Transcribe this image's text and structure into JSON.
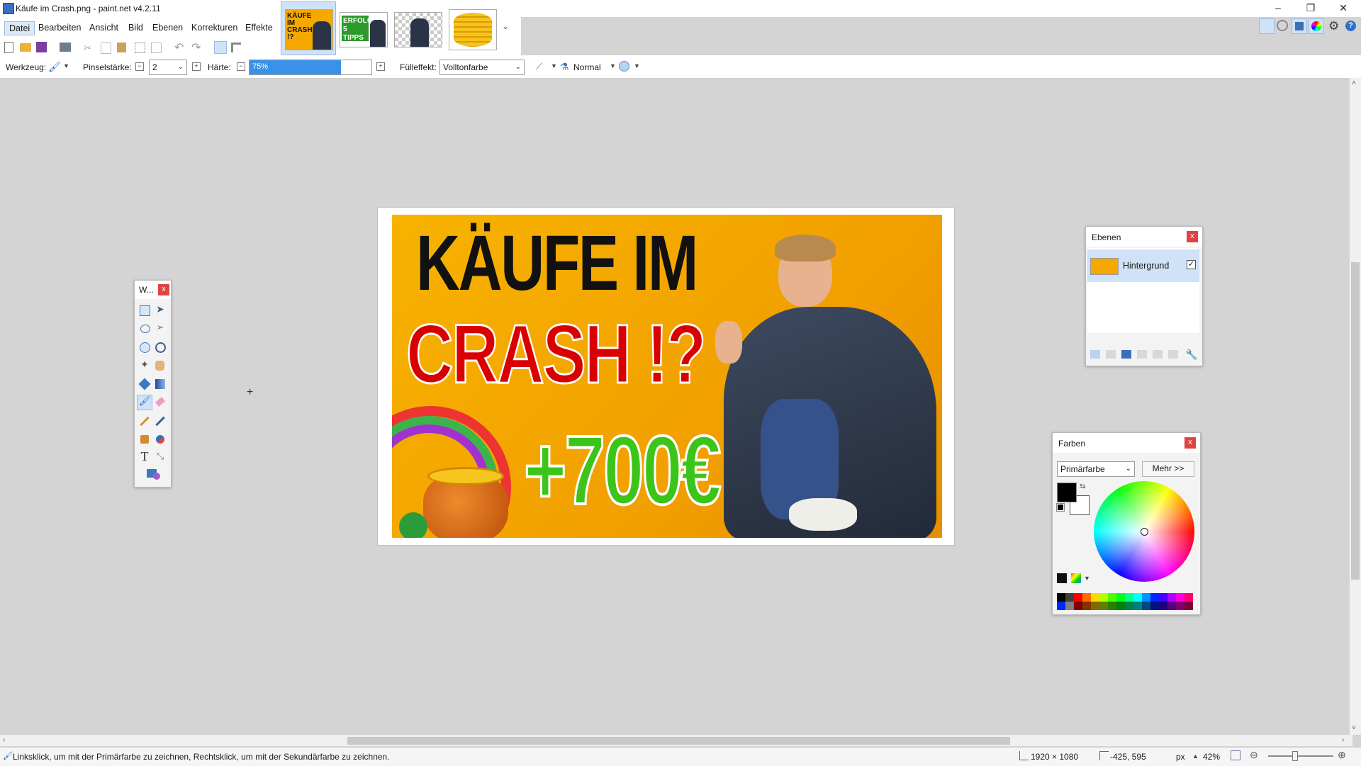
{
  "window": {
    "title": "Käufe im Crash.png - paint.net v4.2.11",
    "minimize": "–",
    "restore": "❐",
    "close": "✕"
  },
  "menu": [
    "Datei",
    "Bearbeiten",
    "Ansicht",
    "Bild",
    "Ebenen",
    "Korrekturen",
    "Effekte"
  ],
  "image_tabs": [
    {
      "name": "kaufe-im-crash",
      "text": "KÄUFE IM CRASH !?",
      "active": true
    },
    {
      "name": "erfolg-5-tipps",
      "text": "ERFOLG 5 TIPPS",
      "active": false
    },
    {
      "name": "person-transparent",
      "text": "",
      "active": false
    },
    {
      "name": "gold-coins",
      "text": "",
      "active": false
    }
  ],
  "tab_overflow": "⌄",
  "options": {
    "tool_label": "Werkzeug:",
    "brush_width_label": "Pinselstärke:",
    "brush_width_value": "2",
    "hardness_label": "Härte:",
    "hardness_value": "75%",
    "hardness_fraction": 0.75,
    "fill_label": "Fülleffekt:",
    "fill_value": "Volltonfarbe",
    "blend_mode": "Normal"
  },
  "canvas_image": {
    "line1": "KÄUFE IM",
    "line2": "CRASH !?",
    "line3": "+700€"
  },
  "tools_window": {
    "title": "W...",
    "close": "x",
    "text_tool_glyph": "T"
  },
  "layers_window": {
    "title": "Ebenen",
    "close": "x",
    "layer_name": "Hintergrund",
    "layer_visible": true
  },
  "colors_window": {
    "title": "Farben",
    "close": "x",
    "mode": "Primärfarbe",
    "more": "Mehr >>",
    "primary": "#000000",
    "secondary": "#ffffff",
    "palette_top": [
      "#000000",
      "#404040",
      "#ff0000",
      "#ff6a00",
      "#ffd800",
      "#b6ff00",
      "#4cff00",
      "#00ff21",
      "#00ff90",
      "#00ffff",
      "#0094ff",
      "#0026ff",
      "#4800ff",
      "#b200ff",
      "#ff00dc",
      "#ff006e"
    ],
    "palette_bottom": [
      "#0026ff",
      "#808080",
      "#7f0000",
      "#7f3300",
      "#7f6a00",
      "#5b7f00",
      "#267f00",
      "#007f0e",
      "#007f46",
      "#007f7f",
      "#004a7f",
      "#00137f",
      "#21007f",
      "#57007f",
      "#7f006e",
      "#7f0037"
    ]
  },
  "status": {
    "hint": "Linksklick, um mit der Primärfarbe zu zeichnen, Rechtsklick, um mit der Sekundärfarbe zu zeichnen.",
    "image_size": "1920 × 1080",
    "cursor_pos": "-425, 595",
    "units": "px",
    "zoom": "42%"
  }
}
